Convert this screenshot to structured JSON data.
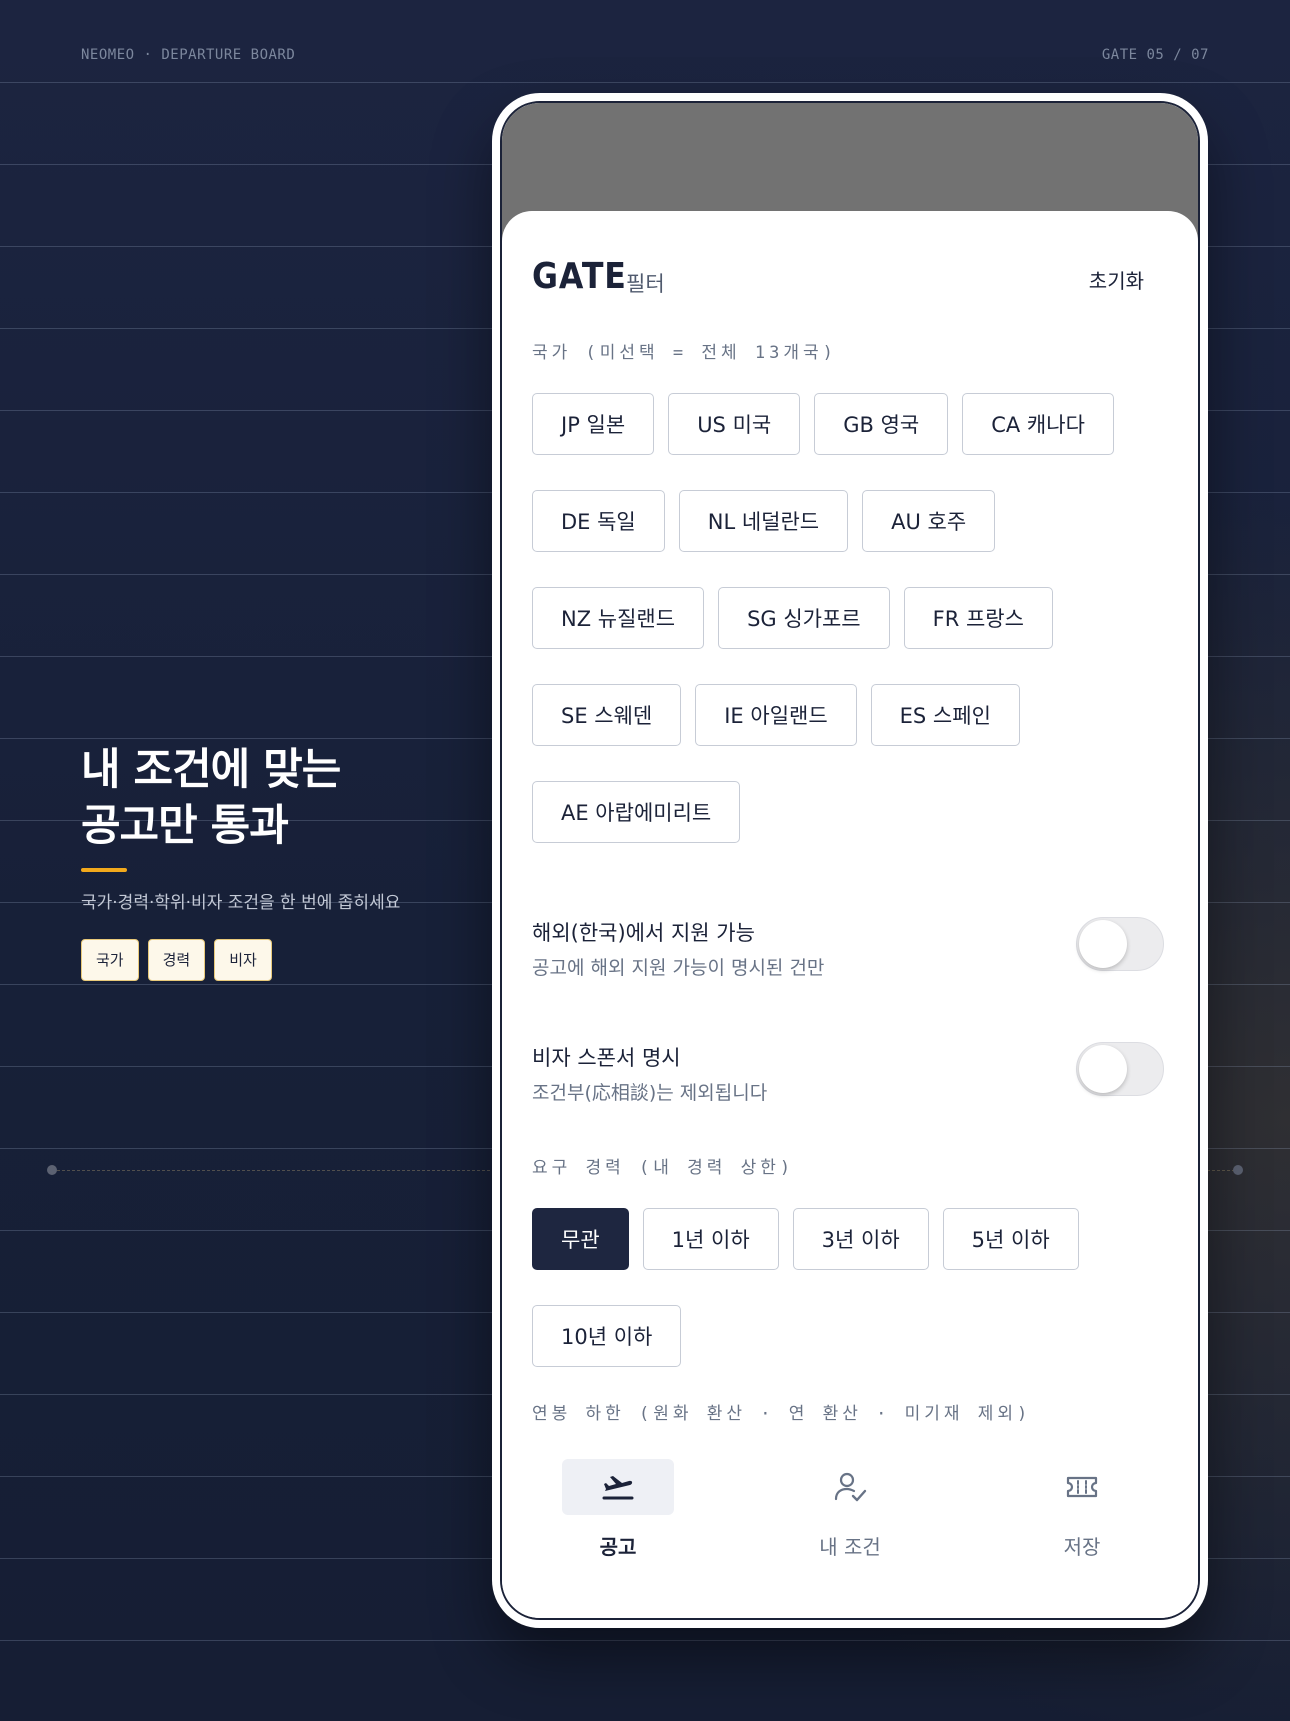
{
  "brand": "NEOMEO · DEPARTURE BOARD",
  "gate_count": "GATE 05 / 07",
  "hero": {
    "title_line1": "내 조건에 맞는",
    "title_line2": "공고만 통과",
    "subtitle": "국가·경력·학위·비자 조건을 한 번에 좁히세요",
    "tags": [
      "국가",
      "경력",
      "비자"
    ]
  },
  "sheet": {
    "title": "GATE",
    "subtitle": "필터",
    "reset_label": "초기화",
    "country_label": "국가 (미선택 = 전체 13개국)",
    "countries": [
      "JP 일본",
      "US 미국",
      "GB 영국",
      "CA 캐나다",
      "DE 독일",
      "NL 네덜란드",
      "AU 호주",
      "NZ 뉴질랜드",
      "SG 싱가포르",
      "FR 프랑스",
      "SE 스웨덴",
      "IE 아일랜드",
      "ES 스페인",
      "AE 아랍에미리트"
    ],
    "toggles": [
      {
        "title": "해외(한국)에서 지원 가능",
        "description": "공고에 해외 지원 가능이 명시된 건만",
        "on": false
      },
      {
        "title": "비자 스폰서 명시",
        "description": "조건부(応相談)는 제외됩니다",
        "on": false
      }
    ],
    "experience_label": "요구 경력 (내 경력 상한)",
    "experience_options": [
      "무관",
      "1년 이하",
      "3년 이하",
      "5년 이하",
      "10년 이하"
    ],
    "experience_selected": "무관",
    "salary_label": "연봉 하한 (원화 환산 · 연 환산 · 미기재 제외)"
  },
  "nav": {
    "items": [
      {
        "label": "공고",
        "icon": "plane-takeoff-icon",
        "active": true
      },
      {
        "label": "내 조건",
        "icon": "user-check-icon",
        "active": false
      },
      {
        "label": "저장",
        "icon": "ticket-icon",
        "active": false
      }
    ]
  },
  "colors": {
    "background": "#1a2240",
    "accent": "#f2a91c",
    "navy": "#1e2640",
    "chip_border": "#c7ccd6"
  }
}
